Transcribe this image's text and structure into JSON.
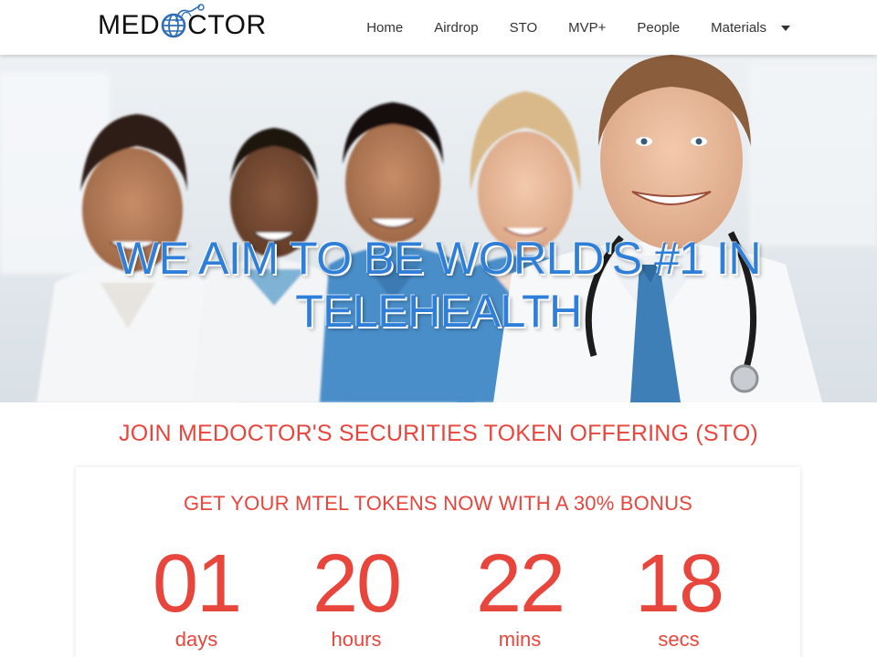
{
  "brand": {
    "name": "MEDOCTOR",
    "name_pre": "MED",
    "name_post": "CTOR"
  },
  "nav": {
    "items": [
      "Home",
      "Airdrop",
      "STO",
      "MVP+",
      "People",
      "Materials"
    ],
    "dropdown_icon": "caret-down-icon"
  },
  "hero": {
    "title_line1": "WE AIM TO BE WORLD'S #1 IN",
    "title_line2": "TELEHEALTH",
    "image": "doctors-team-photo"
  },
  "sto": {
    "heading": "JOIN MEDOCTOR'S SECURITIES TOKEN OFFERING (STO)",
    "card_title": "GET YOUR MTEL TOKENS NOW WITH A 30% BONUS",
    "countdown": [
      {
        "value": "01",
        "label": "days"
      },
      {
        "value": "20",
        "label": "hours"
      },
      {
        "value": "22",
        "label": "mins"
      },
      {
        "value": "18",
        "label": "secs"
      }
    ]
  },
  "colors": {
    "accent": "#e8453c",
    "hero_title": "#2f7fd8",
    "logo_blue": "#2f6fb5"
  }
}
